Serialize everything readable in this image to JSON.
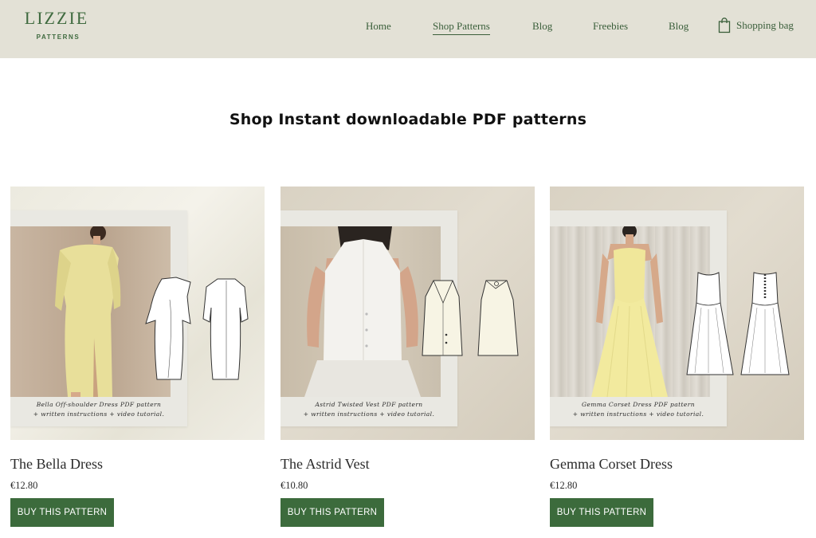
{
  "brand": {
    "name": "LIZZIE",
    "tagline": "PATTERNS"
  },
  "nav": {
    "items": [
      {
        "label": "Home",
        "active": false
      },
      {
        "label": "Shop Patterns",
        "active": true
      },
      {
        "label": "Blog",
        "active": false
      },
      {
        "label": "Freebies",
        "active": false
      },
      {
        "label": "Blog",
        "active": false
      }
    ],
    "bag_label": "Shopping bag",
    "bag_icon": "shopping-bag-icon"
  },
  "heading": "Shop Instant downloadable PDF patterns",
  "colors": {
    "header_bg": "#e3e1d6",
    "brand_green": "#3c6b3c",
    "button_text": "#ffffff"
  },
  "products": [
    {
      "title": "The Bella Dress",
      "price": "€12.80",
      "button": "BUY THIS PATTERN",
      "caption_line1": "Bella Off-shoulder Dress PDF pattern",
      "caption_line2": "+ written instructions + video tutorial."
    },
    {
      "title": "The Astrid Vest",
      "price": "€10.80",
      "button": "BUY THIS PATTERN",
      "caption_line1": "Astrid Twisted Vest PDF pattern",
      "caption_line2": "+ written instructions + video tutorial."
    },
    {
      "title": "Gemma Corset Dress",
      "price": "€12.80",
      "button": "BUY THIS PATTERN",
      "caption_line1": "Gemma Corset Dress PDF pattern",
      "caption_line2": "+ written instructions + video tutorial."
    }
  ]
}
